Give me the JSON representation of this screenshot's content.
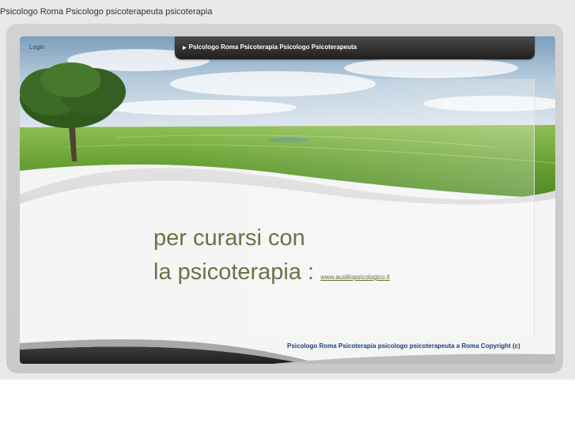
{
  "page": {
    "title": "Psicologo Roma Psicologo psicoterapeuta psicoterapia"
  },
  "header": {
    "login_label": "Login",
    "nav_label": "Psicologo Roma Psicoterapia  Psicologo Psicoterapeuta",
    "nav_arrow_icon": "triangle-right"
  },
  "main": {
    "headline_line1": "per curarsi con",
    "headline_line2": "la psicoterapia :",
    "link_text": "www.ausiliopsicologico.it"
  },
  "footer": {
    "text": "Psicologo Roma Psicoterapia psicologo psicoterapeuta a Roma Copyright (c)"
  },
  "colors": {
    "headline": "#6b7245",
    "footer_text": "#1c3f6e",
    "nav_bg": "#2a2a2a",
    "grass": "#6fa53a",
    "sky": "#a9c2d6"
  }
}
